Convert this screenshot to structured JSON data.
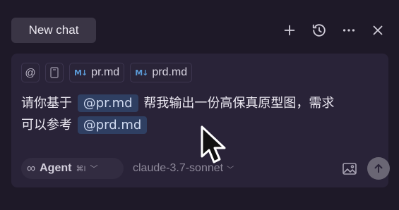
{
  "header": {
    "tab_title": "New chat",
    "icons": [
      "plus-icon",
      "history-icon",
      "more-icon",
      "close-icon"
    ]
  },
  "composer": {
    "context_chips": [
      {
        "icon": "at-icon",
        "label": "@"
      },
      {
        "icon": "file-icon",
        "label": ""
      },
      {
        "icon": "markdown-icon",
        "badge": "M↓",
        "label": "pr.md"
      },
      {
        "icon": "markdown-icon",
        "badge": "M↓",
        "label": "prd.md"
      }
    ],
    "message": {
      "part1": "请你基于",
      "mention1": "@pr.md",
      "part2": "帮我输出一份高保真原型图，需求",
      "part3": "可以参考",
      "mention2": "@prd.md"
    },
    "mode": {
      "label": "Agent",
      "shortcut": "⌘I",
      "symbol": "∞"
    },
    "model": "claude-3.7-sonnet"
  },
  "colors": {
    "background": "#1e1928",
    "composer": "#292338",
    "mention_bg": "#2f3f62",
    "markdown_icon": "#5b9ad6"
  }
}
